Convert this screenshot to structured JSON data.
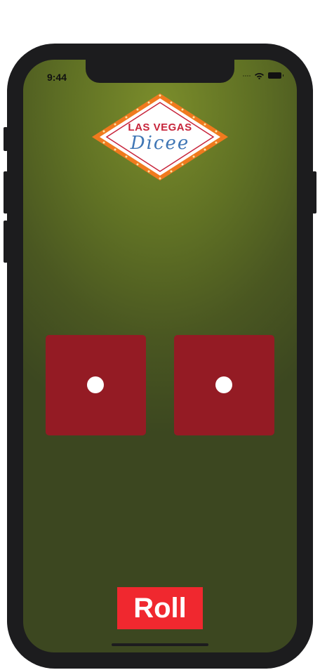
{
  "status_bar": {
    "time": "9:44",
    "icons": [
      "signal-dots-icon",
      "wifi-icon",
      "battery-icon"
    ]
  },
  "logo": {
    "line1": "LAS VEGAS",
    "line2": "Dicee",
    "colors": {
      "border_lights": "#f07a1e",
      "line1_text": "#c7243a",
      "line2_text": "#3f76b5"
    }
  },
  "dice": [
    {
      "name": "left-die",
      "value": 1
    },
    {
      "name": "right-die",
      "value": 1
    }
  ],
  "roll_button": {
    "label": "Roll"
  },
  "colors": {
    "background": "#5f7024",
    "die": "#941b24",
    "pip": "#ffffff",
    "button": "#f0282f",
    "button_text": "#ffffff"
  }
}
